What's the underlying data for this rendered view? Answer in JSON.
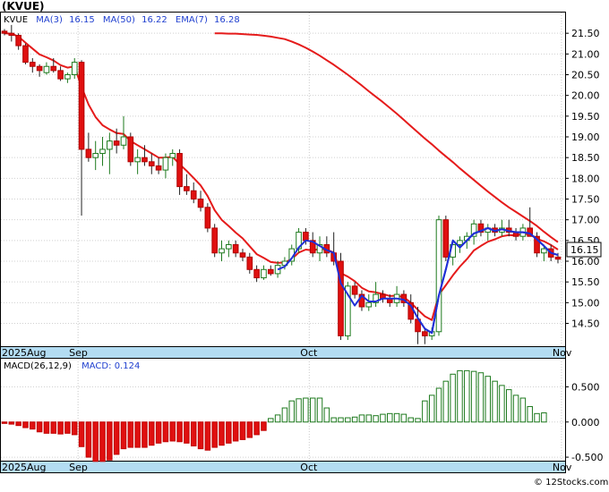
{
  "title": "(KVUE)",
  "watermark": "© 12Stocks.com",
  "chart_data": [
    {
      "type": "candlestick",
      "legend": {
        "symbol": "KVUE",
        "ma3_label": "MA(3)",
        "ma3_value": "16.15",
        "ma50_label": "MA(50)",
        "ma50_value": "16.22",
        "ema7_label": "EMA(7)",
        "ema7_value": "16.28"
      },
      "last_price": "16.15",
      "ylim": [
        13.95,
        22.0
      ],
      "y_ticks": [
        "21.50",
        "21.00",
        "20.50",
        "20.00",
        "19.50",
        "19.00",
        "18.50",
        "18.00",
        "17.50",
        "17.00",
        "16.50",
        "16.00",
        "15.50",
        "15.00",
        "14.50"
      ],
      "x_labels": [
        {
          "label": "2025Aug",
          "i": 0
        },
        {
          "label": "Sep",
          "i": 11
        },
        {
          "label": "Oct",
          "i": 44
        },
        {
          "label": "Nov",
          "i": 80
        }
      ],
      "candles": [
        [
          21.55,
          21.6,
          21.45,
          21.5
        ],
        [
          21.5,
          21.7,
          21.3,
          21.45
        ],
        [
          21.45,
          21.5,
          21.1,
          21.2
        ],
        [
          21.2,
          21.25,
          20.75,
          20.8
        ],
        [
          20.8,
          20.9,
          20.55,
          20.7
        ],
        [
          20.7,
          20.75,
          20.45,
          20.6
        ],
        [
          20.55,
          20.8,
          20.5,
          20.7
        ],
        [
          20.7,
          20.9,
          20.55,
          20.6
        ],
        [
          20.6,
          20.7,
          20.35,
          20.4
        ],
        [
          20.4,
          20.55,
          20.3,
          20.5
        ],
        [
          20.5,
          20.9,
          20.4,
          20.8
        ],
        [
          20.8,
          20.85,
          17.1,
          18.7
        ],
        [
          18.7,
          19.1,
          18.4,
          18.5
        ],
        [
          18.5,
          18.9,
          18.2,
          18.6
        ],
        [
          18.6,
          19.0,
          18.3,
          18.7
        ],
        [
          18.7,
          19.1,
          18.1,
          18.9
        ],
        [
          18.9,
          19.2,
          18.6,
          18.8
        ],
        [
          18.8,
          19.5,
          18.7,
          19.0
        ],
        [
          19.0,
          19.1,
          18.3,
          18.4
        ],
        [
          18.4,
          18.7,
          18.1,
          18.5
        ],
        [
          18.5,
          18.8,
          18.3,
          18.4
        ],
        [
          18.4,
          18.6,
          18.1,
          18.3
        ],
        [
          18.3,
          18.5,
          18.1,
          18.2
        ],
        [
          18.2,
          18.6,
          18.0,
          18.5
        ],
        [
          18.5,
          18.7,
          18.3,
          18.6
        ],
        [
          18.6,
          18.7,
          17.6,
          17.8
        ],
        [
          17.8,
          18.1,
          17.6,
          17.7
        ],
        [
          17.7,
          17.9,
          17.4,
          17.5
        ],
        [
          17.5,
          17.7,
          17.2,
          17.3
        ],
        [
          17.3,
          17.4,
          16.7,
          16.8
        ],
        [
          16.8,
          16.9,
          16.1,
          16.2
        ],
        [
          16.2,
          16.5,
          16.0,
          16.3
        ],
        [
          16.3,
          16.5,
          16.1,
          16.4
        ],
        [
          16.4,
          16.5,
          16.1,
          16.2
        ],
        [
          16.2,
          16.3,
          16.0,
          16.1
        ],
        [
          16.1,
          16.2,
          15.7,
          15.8
        ],
        [
          15.8,
          15.9,
          15.5,
          15.6
        ],
        [
          15.6,
          15.9,
          15.55,
          15.8
        ],
        [
          15.8,
          15.9,
          15.65,
          15.7
        ],
        [
          15.7,
          16.0,
          15.6,
          15.9
        ],
        [
          15.9,
          16.1,
          15.8,
          16.0
        ],
        [
          16.0,
          16.4,
          15.9,
          16.3
        ],
        [
          16.3,
          16.8,
          16.2,
          16.7
        ],
        [
          16.7,
          16.8,
          16.4,
          16.5
        ],
        [
          16.5,
          16.7,
          16.1,
          16.2
        ],
        [
          16.2,
          16.6,
          16.0,
          16.4
        ],
        [
          16.4,
          16.6,
          16.1,
          16.2
        ],
        [
          16.2,
          16.7,
          15.9,
          16.0
        ],
        [
          16.0,
          16.2,
          14.1,
          14.2
        ],
        [
          14.2,
          15.5,
          14.1,
          15.4
        ],
        [
          15.4,
          15.5,
          15.1,
          15.2
        ],
        [
          15.2,
          15.3,
          14.8,
          14.9
        ],
        [
          14.9,
          15.2,
          14.8,
          15.0
        ],
        [
          15.0,
          15.5,
          14.9,
          15.2
        ],
        [
          15.2,
          15.3,
          15.0,
          15.1
        ],
        [
          15.1,
          15.2,
          14.9,
          15.0
        ],
        [
          15.0,
          15.4,
          14.9,
          15.2
        ],
        [
          15.2,
          15.3,
          14.9,
          15.0
        ],
        [
          15.0,
          15.2,
          14.5,
          14.6
        ],
        [
          14.6,
          14.9,
          14.0,
          14.3
        ],
        [
          14.3,
          14.4,
          14.0,
          14.2
        ],
        [
          14.2,
          14.4,
          14.1,
          14.3
        ],
        [
          14.3,
          17.1,
          14.2,
          17.0
        ],
        [
          17.0,
          17.1,
          16.0,
          16.1
        ],
        [
          16.1,
          16.5,
          15.9,
          16.4
        ],
        [
          16.4,
          16.6,
          16.2,
          16.5
        ],
        [
          16.5,
          16.7,
          16.3,
          16.6
        ],
        [
          16.6,
          17.0,
          16.4,
          16.9
        ],
        [
          16.9,
          17.0,
          16.6,
          16.7
        ],
        [
          16.7,
          16.9,
          16.5,
          16.8
        ],
        [
          16.8,
          16.9,
          16.6,
          16.7
        ],
        [
          16.7,
          17.0,
          16.6,
          16.8
        ],
        [
          16.8,
          17.0,
          16.6,
          16.7
        ],
        [
          16.7,
          16.8,
          16.5,
          16.6
        ],
        [
          16.6,
          16.9,
          16.5,
          16.8
        ],
        [
          16.8,
          17.3,
          16.6,
          16.6
        ],
        [
          16.6,
          16.7,
          16.1,
          16.2
        ],
        [
          16.2,
          16.4,
          16.0,
          16.3
        ],
        [
          16.3,
          16.4,
          16.0,
          16.1
        ],
        [
          16.1,
          16.2,
          15.95,
          16.05
        ]
      ],
      "ma3": [
        21.5,
        21.48,
        21.38,
        21.15,
        20.9,
        20.7,
        20.63,
        20.63,
        20.57,
        20.5,
        20.57,
        19.33,
        19.33,
        18.6,
        18.6,
        18.73,
        18.8,
        18.9,
        18.73,
        18.63,
        18.43,
        18.4,
        18.3,
        18.33,
        18.43,
        18.3,
        18.03,
        17.67,
        17.5,
        17.2,
        16.77,
        16.43,
        16.3,
        16.3,
        16.23,
        16.03,
        15.83,
        15.73,
        15.7,
        15.8,
        15.87,
        16.07,
        16.33,
        16.5,
        16.47,
        16.37,
        16.27,
        16.2,
        15.47,
        15.2,
        14.93,
        15.17,
        15.03,
        15.03,
        15.1,
        15.1,
        15.1,
        15.07,
        14.93,
        14.63,
        14.37,
        14.27,
        15.17,
        15.8,
        16.5,
        16.33,
        16.5,
        16.67,
        16.73,
        16.8,
        16.73,
        16.77,
        16.73,
        16.7,
        16.7,
        16.67,
        16.53,
        16.37,
        16.2,
        16.15
      ],
      "ema7": [
        21.5,
        21.49,
        21.42,
        21.27,
        21.13,
        20.99,
        20.92,
        20.84,
        20.73,
        20.67,
        20.7,
        20.2,
        19.78,
        19.48,
        19.28,
        19.18,
        19.09,
        19.07,
        18.9,
        18.8,
        18.7,
        18.6,
        18.5,
        18.5,
        18.52,
        18.34,
        18.18,
        18.01,
        17.83,
        17.57,
        17.23,
        17.0,
        16.85,
        16.69,
        16.55,
        16.36,
        16.17,
        16.08,
        15.98,
        15.96,
        15.97,
        16.05,
        16.21,
        16.28,
        16.26,
        16.3,
        16.28,
        16.21,
        15.71,
        15.63,
        15.52,
        15.36,
        15.27,
        15.25,
        15.21,
        15.16,
        15.17,
        15.13,
        15.0,
        14.83,
        14.67,
        14.58,
        15.19,
        15.42,
        15.66,
        15.87,
        16.05,
        16.26,
        16.37,
        16.47,
        16.53,
        16.6,
        16.63,
        16.62,
        16.66,
        16.65,
        16.54,
        16.48,
        16.39,
        16.28
      ],
      "ma50": [
        21.5,
        21.5,
        21.49,
        21.49,
        21.48,
        21.47,
        21.46,
        21.44,
        21.42,
        21.39,
        21.36,
        21.3,
        21.23,
        21.15,
        21.06,
        20.96,
        20.85,
        20.74,
        20.62,
        20.5,
        20.37,
        20.24,
        20.1,
        19.97,
        19.84,
        19.7,
        19.56,
        19.41,
        19.26,
        19.11,
        18.96,
        18.82,
        18.67,
        18.53,
        18.39,
        18.24,
        18.1,
        17.96,
        17.82,
        17.68,
        17.55,
        17.42,
        17.3,
        17.19,
        17.08,
        16.97,
        16.85,
        16.71,
        16.58,
        16.46
      ],
      "ma50_start": 30
    },
    {
      "type": "bar",
      "legend": {
        "macd_label": "MACD(26,12,9)",
        "macd_value_label": "MACD:",
        "macd_value": "0.124"
      },
      "ylim": [
        -0.55,
        0.9
      ],
      "y_ticks": [
        "0.500",
        "0.000",
        "-0.500"
      ],
      "x_labels": [
        {
          "label": "2025Aug",
          "i": 0
        },
        {
          "label": "Sep",
          "i": 11
        },
        {
          "label": "Oct",
          "i": 44
        },
        {
          "label": "Nov",
          "i": 80
        }
      ],
      "values": [
        -0.02,
        -0.03,
        -0.05,
        -0.08,
        -0.1,
        -0.14,
        -0.16,
        -0.16,
        -0.17,
        -0.16,
        -0.18,
        -0.35,
        -0.5,
        -0.56,
        -0.56,
        -0.54,
        -0.46,
        -0.38,
        -0.36,
        -0.36,
        -0.36,
        -0.33,
        -0.3,
        -0.28,
        -0.27,
        -0.28,
        -0.3,
        -0.34,
        -0.38,
        -0.4,
        -0.36,
        -0.33,
        -0.3,
        -0.27,
        -0.25,
        -0.22,
        -0.18,
        -0.12,
        0.05,
        0.1,
        0.2,
        0.3,
        0.33,
        0.34,
        0.34,
        0.34,
        0.2,
        0.06,
        0.06,
        0.06,
        0.07,
        0.1,
        0.1,
        0.09,
        0.11,
        0.12,
        0.12,
        0.11,
        0.06,
        0.05,
        0.3,
        0.38,
        0.48,
        0.58,
        0.68,
        0.73,
        0.73,
        0.72,
        0.7,
        0.65,
        0.58,
        0.52,
        0.46,
        0.38,
        0.34,
        0.22,
        0.12,
        0.13
      ]
    }
  ]
}
